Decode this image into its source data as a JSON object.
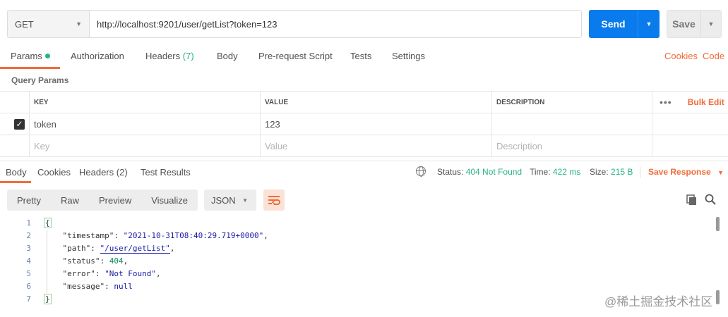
{
  "request": {
    "method": "GET",
    "url": "http://localhost:9201/user/getList?token=123",
    "send_label": "Send",
    "save_label": "Save"
  },
  "request_tabs": {
    "params": "Params",
    "authorization": "Authorization",
    "headers": "Headers",
    "headers_count": "(7)",
    "body": "Body",
    "prerequest": "Pre-request Script",
    "tests": "Tests",
    "settings": "Settings",
    "cookies_link": "Cookies",
    "code_link": "Code"
  },
  "query_params": {
    "title": "Query Params",
    "headers": {
      "key": "KEY",
      "value": "VALUE",
      "description": "DESCRIPTION",
      "bulk_edit": "Bulk Edit",
      "more": "•••"
    },
    "rows": [
      {
        "checked": true,
        "key": "token",
        "value": "123",
        "description": ""
      }
    ],
    "placeholder": {
      "key": "Key",
      "value": "Value",
      "description": "Description"
    }
  },
  "response_tabs": {
    "body": "Body",
    "cookies": "Cookies",
    "headers": "Headers",
    "headers_count": "(2)",
    "test_results": "Test Results"
  },
  "response_status": {
    "status_label": "Status:",
    "status_value": "404 Not Found",
    "time_label": "Time:",
    "time_value": "422 ms",
    "size_label": "Size:",
    "size_value": "215 B",
    "save_response": "Save Response"
  },
  "view_toolbar": {
    "pretty": "Pretty",
    "raw": "Raw",
    "preview": "Preview",
    "visualize": "Visualize",
    "format": "JSON"
  },
  "response_body": {
    "line_numbers": [
      "1",
      "2",
      "3",
      "4",
      "5",
      "6",
      "7"
    ],
    "open_brace": "{",
    "close_brace": "}",
    "fields": [
      {
        "key": "\"timestamp\"",
        "value": "\"2021-10-31T08:40:29.719+0000\"",
        "type": "string",
        "comma": ","
      },
      {
        "key": "\"path\"",
        "value": "\"/user/getList\"",
        "type": "string",
        "comma": ","
      },
      {
        "key": "\"status\"",
        "value": "404",
        "type": "number",
        "comma": ","
      },
      {
        "key": "\"error\"",
        "value": "\"Not Found\"",
        "type": "string",
        "comma": ","
      },
      {
        "key": "\"message\"",
        "value": "null",
        "type": "keyword",
        "comma": ""
      }
    ]
  },
  "watermark": "@稀土掘金技术社区",
  "colors": {
    "accent": "#f26b3a",
    "send": "#097bed",
    "success": "#26b47f"
  }
}
